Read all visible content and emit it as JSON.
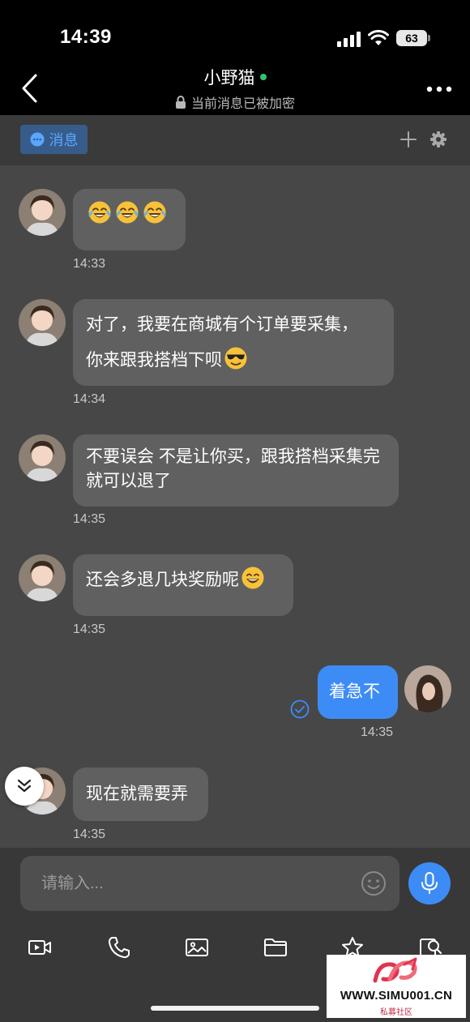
{
  "status_bar": {
    "time": "14:39",
    "battery": "63"
  },
  "header": {
    "contact_name": "小野猫",
    "encryption_text": "当前消息已被加密"
  },
  "tabs": {
    "messages_label": "消息"
  },
  "messages": [
    {
      "direction": "in",
      "text": "",
      "emoji": [
        "tears-of-joy",
        "tears-of-joy",
        "tears-of-joy"
      ],
      "time": "14:33"
    },
    {
      "direction": "in",
      "text_line1": "对了，我要在商城有个订单要采集，",
      "text_line2": "你来跟我搭档下呗",
      "emoji": [
        "sunglasses"
      ],
      "time": "14:34"
    },
    {
      "direction": "in",
      "text": "不要误会 不是让你买，跟我搭档采集完就可以退了",
      "time": "14:35"
    },
    {
      "direction": "in",
      "text": "还会多退几块奖励呢",
      "emoji": [
        "grinning"
      ],
      "time": "14:35"
    },
    {
      "direction": "out",
      "text": "着急不",
      "time": "14:35",
      "read": true
    },
    {
      "direction": "in",
      "text": "现在就需要弄",
      "time": "14:35"
    }
  ],
  "input": {
    "placeholder": "请输入..."
  },
  "toolbar": [
    "video-icon",
    "phone-icon",
    "image-icon",
    "folder-icon",
    "star-icon",
    "search-doc-icon"
  ],
  "watermark": {
    "url": "WWW.SIMU001.CN",
    "sub": "私募社区"
  },
  "colors": {
    "accent": "#3d8cf6",
    "bubble_in": "#606060",
    "chat_bg": "#474747",
    "online": "#31c36b"
  }
}
